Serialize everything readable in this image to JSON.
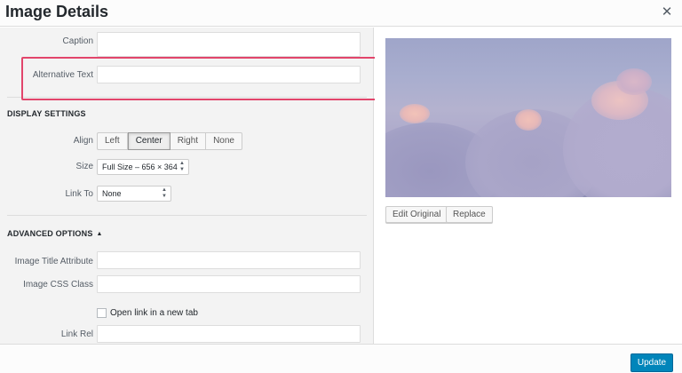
{
  "dialog": {
    "title": "Image Details",
    "close_icon": "close-icon"
  },
  "fields": {
    "caption": {
      "label": "Caption",
      "value": ""
    },
    "alt_text": {
      "label": "Alternative Text",
      "value": ""
    }
  },
  "display_settings": {
    "heading": "DISPLAY SETTINGS",
    "align": {
      "label": "Align",
      "options": [
        "Left",
        "Center",
        "Right",
        "None"
      ],
      "selected": "Center"
    },
    "size": {
      "label": "Size",
      "value": "Full Size – 656 × 364"
    },
    "link_to": {
      "label": "Link To",
      "value": "None"
    }
  },
  "advanced_options": {
    "heading": "ADVANCED OPTIONS",
    "toggle_icon": "triangle-up-icon",
    "image_title": {
      "label": "Image Title Attribute",
      "value": ""
    },
    "css_class": {
      "label": "Image CSS Class",
      "value": ""
    },
    "new_tab": {
      "label": "Open link in a new tab",
      "checked": false
    },
    "link_rel": {
      "label": "Link Rel",
      "value": ""
    }
  },
  "preview": {
    "edit_label": "Edit Original",
    "replace_label": "Replace"
  },
  "footer": {
    "update_label": "Update"
  },
  "colors": {
    "primary": "#0085ba",
    "highlight": "#e2456b"
  }
}
